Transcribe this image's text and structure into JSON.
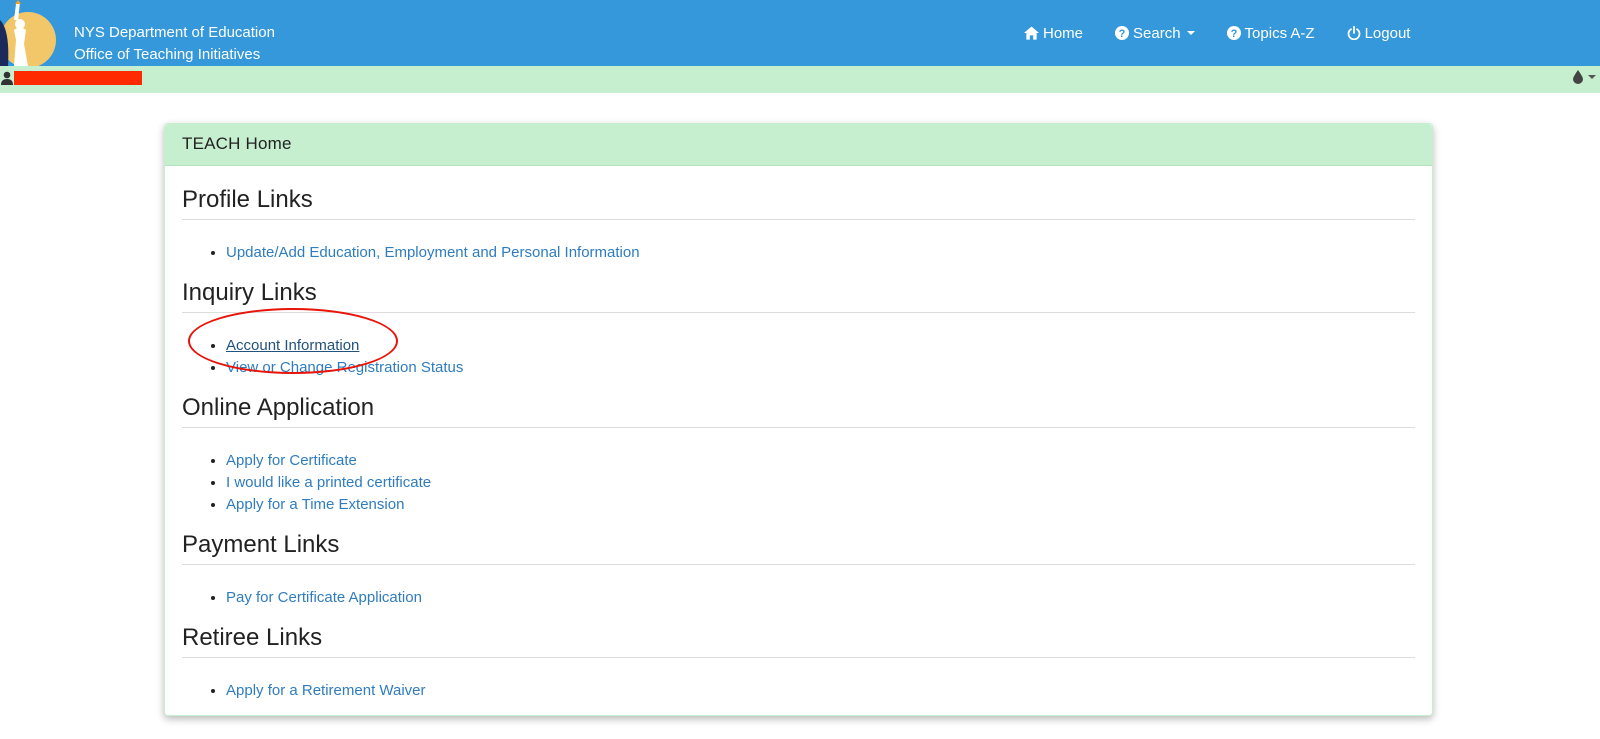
{
  "header": {
    "org_line1": "NYS Department of Education",
    "org_line2": "Office of Teaching Initiatives",
    "nav": [
      {
        "label": "Home",
        "icon": "home-icon"
      },
      {
        "label": "Search",
        "icon": "question-circle-icon",
        "dropdown": true
      },
      {
        "label": "Topics A-Z",
        "icon": "question-circle-icon"
      },
      {
        "label": "Logout",
        "icon": "power-icon"
      }
    ]
  },
  "userbar": {
    "user_icon": "user-icon",
    "theme_icon": "drop-icon"
  },
  "panel": {
    "title": "TEACH Home",
    "sections": [
      {
        "title": "Profile Links",
        "links": [
          "Update/Add Education, Employment and Personal Information"
        ]
      },
      {
        "title": "Inquiry Links",
        "links": [
          "Account Information",
          "View or Change Registration Status"
        ]
      },
      {
        "title": "Online Application",
        "links": [
          "Apply for Certificate",
          "I would like a printed certificate",
          "Apply for a Time Extension"
        ]
      },
      {
        "title": "Payment Links",
        "links": [
          "Pay for Certificate Application"
        ]
      },
      {
        "title": "Retiree Links",
        "links": [
          "Apply for a Retirement Waiver"
        ]
      }
    ]
  },
  "colors": {
    "navbar": "#3498db",
    "userbar": "#c6efd0",
    "link": "#2f7cbf",
    "annotation": "#e8140a"
  }
}
